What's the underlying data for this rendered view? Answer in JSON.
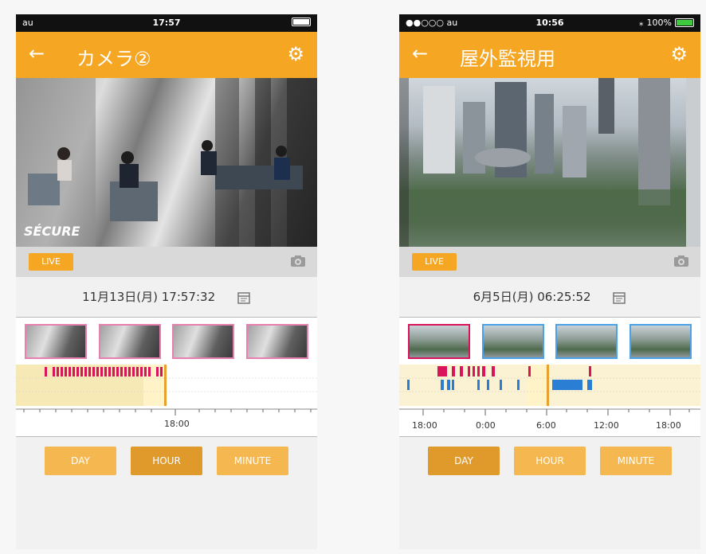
{
  "left_phone": {
    "status": {
      "carrier": "au",
      "time": "17:57"
    },
    "appbar": {
      "title": "カメラ②",
      "back_icon": "arrow-left-icon",
      "settings_icon": "gear-icon"
    },
    "video": {
      "watermark": "SÉCURE"
    },
    "controls": {
      "live_label": "LIVE"
    },
    "date": {
      "text": "11月13日(月)  17:57:32"
    },
    "timeline": {
      "tick_labels": [
        "18:00"
      ]
    },
    "buttons": {
      "day": "DAY",
      "hour": "HOUR",
      "minute": "MINUTE",
      "selected": "HOUR"
    }
  },
  "right_phone": {
    "status": {
      "carrier": "●●○○○ au",
      "time": "10:56",
      "battery": "100%"
    },
    "appbar": {
      "title": "屋外監視用",
      "back_icon": "arrow-left-icon",
      "settings_icon": "gear-icon"
    },
    "controls": {
      "live_label": "LIVE"
    },
    "date": {
      "text": "6月5日(月)  06:25:52"
    },
    "timeline": {
      "tick_labels": [
        "18:00",
        "0:00",
        "6:00",
        "12:00",
        "18:00"
      ]
    },
    "buttons": {
      "day": "DAY",
      "hour": "HOUR",
      "minute": "MINUTE",
      "selected": "DAY"
    }
  },
  "colors": {
    "accent": "#f5a623",
    "event_red": "#d9145a",
    "event_blue": "#2a7fd4",
    "playhead": "#e8a030",
    "recorded_bg": "#f7e9b6"
  }
}
